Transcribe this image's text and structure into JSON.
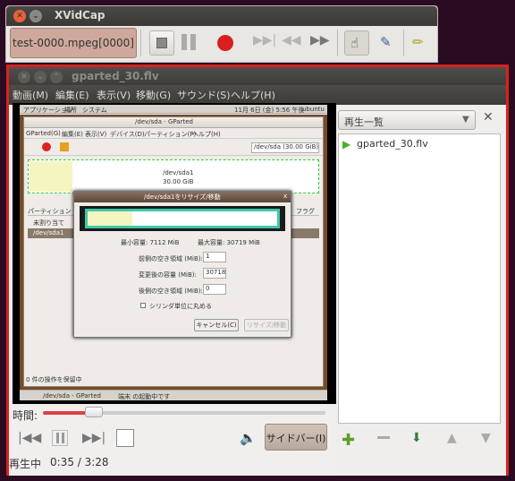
{
  "xvidcap": {
    "title": "XVidCap",
    "filename": "test-0000.mpeg[0000]"
  },
  "player": {
    "title": "gparted_30.flv",
    "menus": [
      "動画(M)",
      "編集(E)",
      "表示(V)",
      "移動(G)",
      "サウンド(S)",
      "ヘルプ(H)"
    ],
    "time_label": "時間:",
    "sidebar_button": "サイドバー(I)",
    "status": "再生中",
    "time": "0:35 / 3:28",
    "seek_position": 0.18
  },
  "sidebar": {
    "dropdown": "再生一覧",
    "playlist": [
      "gparted_30.flv"
    ]
  },
  "video_content": {
    "panel": [
      "アプリケーション",
      "場所",
      "システム"
    ],
    "panel_right": "11月 6日 (金) 5:56 午後",
    "panel_user": "ubuntu",
    "window_title": "/dev/sda - GParted",
    "gp_menu": [
      "GParted(G)",
      "編集(E)",
      "表示(V)",
      "デバイス(D)",
      "パーティション(P)",
      "ヘルプ(H)"
    ],
    "device_combo": "/dev/sda (30.00 GiB)",
    "partition_label": "/dev/sda1",
    "partition_size": "30.00 GiB",
    "col_partition": "パーティション",
    "col_flag": "フラグ",
    "row_unallocated": "未割り当て",
    "row_sda1": "/dev/sda1",
    "pending": "0 件の操作を保留中",
    "dialog_title": "/dev/sda1をリサイズ/移動",
    "min_size": "最小容量: 7112 MiB",
    "max_size": "最大容量: 30719 MiB",
    "free_before_label": "前側の空き領域 (MiB):",
    "free_before_val": "1",
    "new_size_label": "変更後の容量 (MiB):",
    "new_size_val": "30718",
    "free_after_label": "後側の空き領域 (MiB):",
    "free_after_val": "0",
    "cylinder_label": "シリンダ単位に丸める",
    "cancel": "キャンセル(C)",
    "resize": "リサイズ/移動",
    "taskbar1": "/dev/sda - GParted",
    "taskbar2": "端末 の起動中です"
  }
}
